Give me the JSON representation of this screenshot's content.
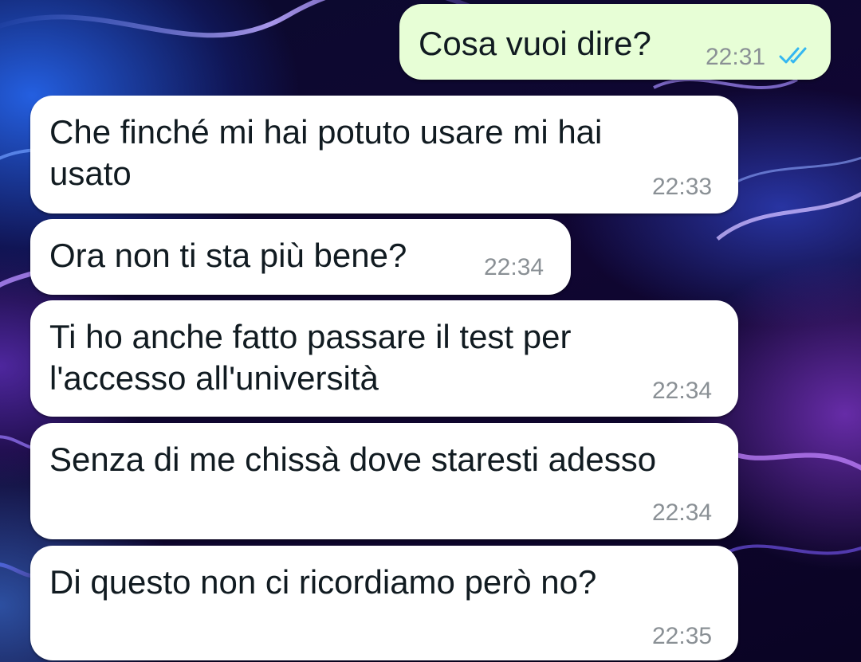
{
  "chat": {
    "messages": [
      {
        "direction": "outgoing",
        "text": "Cosa vuoi dire?",
        "time": "22:31",
        "status_icon": "double-check-read-icon",
        "status_color": "#34b7f1"
      },
      {
        "direction": "incoming",
        "text": "Che finché mi hai potuto usare mi hai\nusato",
        "time": "22:33"
      },
      {
        "direction": "incoming",
        "text": "Ora non ti sta più bene?",
        "time": "22:34"
      },
      {
        "direction": "incoming",
        "text": "Ti ho anche fatto passare il test per\nl'accesso all'università",
        "time": "22:34"
      },
      {
        "direction": "incoming",
        "text": "Senza di me chissà dove staresti adesso",
        "time": "22:34"
      },
      {
        "direction": "incoming",
        "text": "Di questo non ci ricordiamo però no?",
        "time": "22:35"
      }
    ],
    "colors": {
      "incoming_bubble": "#ffffff",
      "outgoing_bubble": "#e7fed6",
      "text": "#111b21",
      "timestamp": "#8a9095",
      "read_ticks": "#34b7f1"
    }
  }
}
